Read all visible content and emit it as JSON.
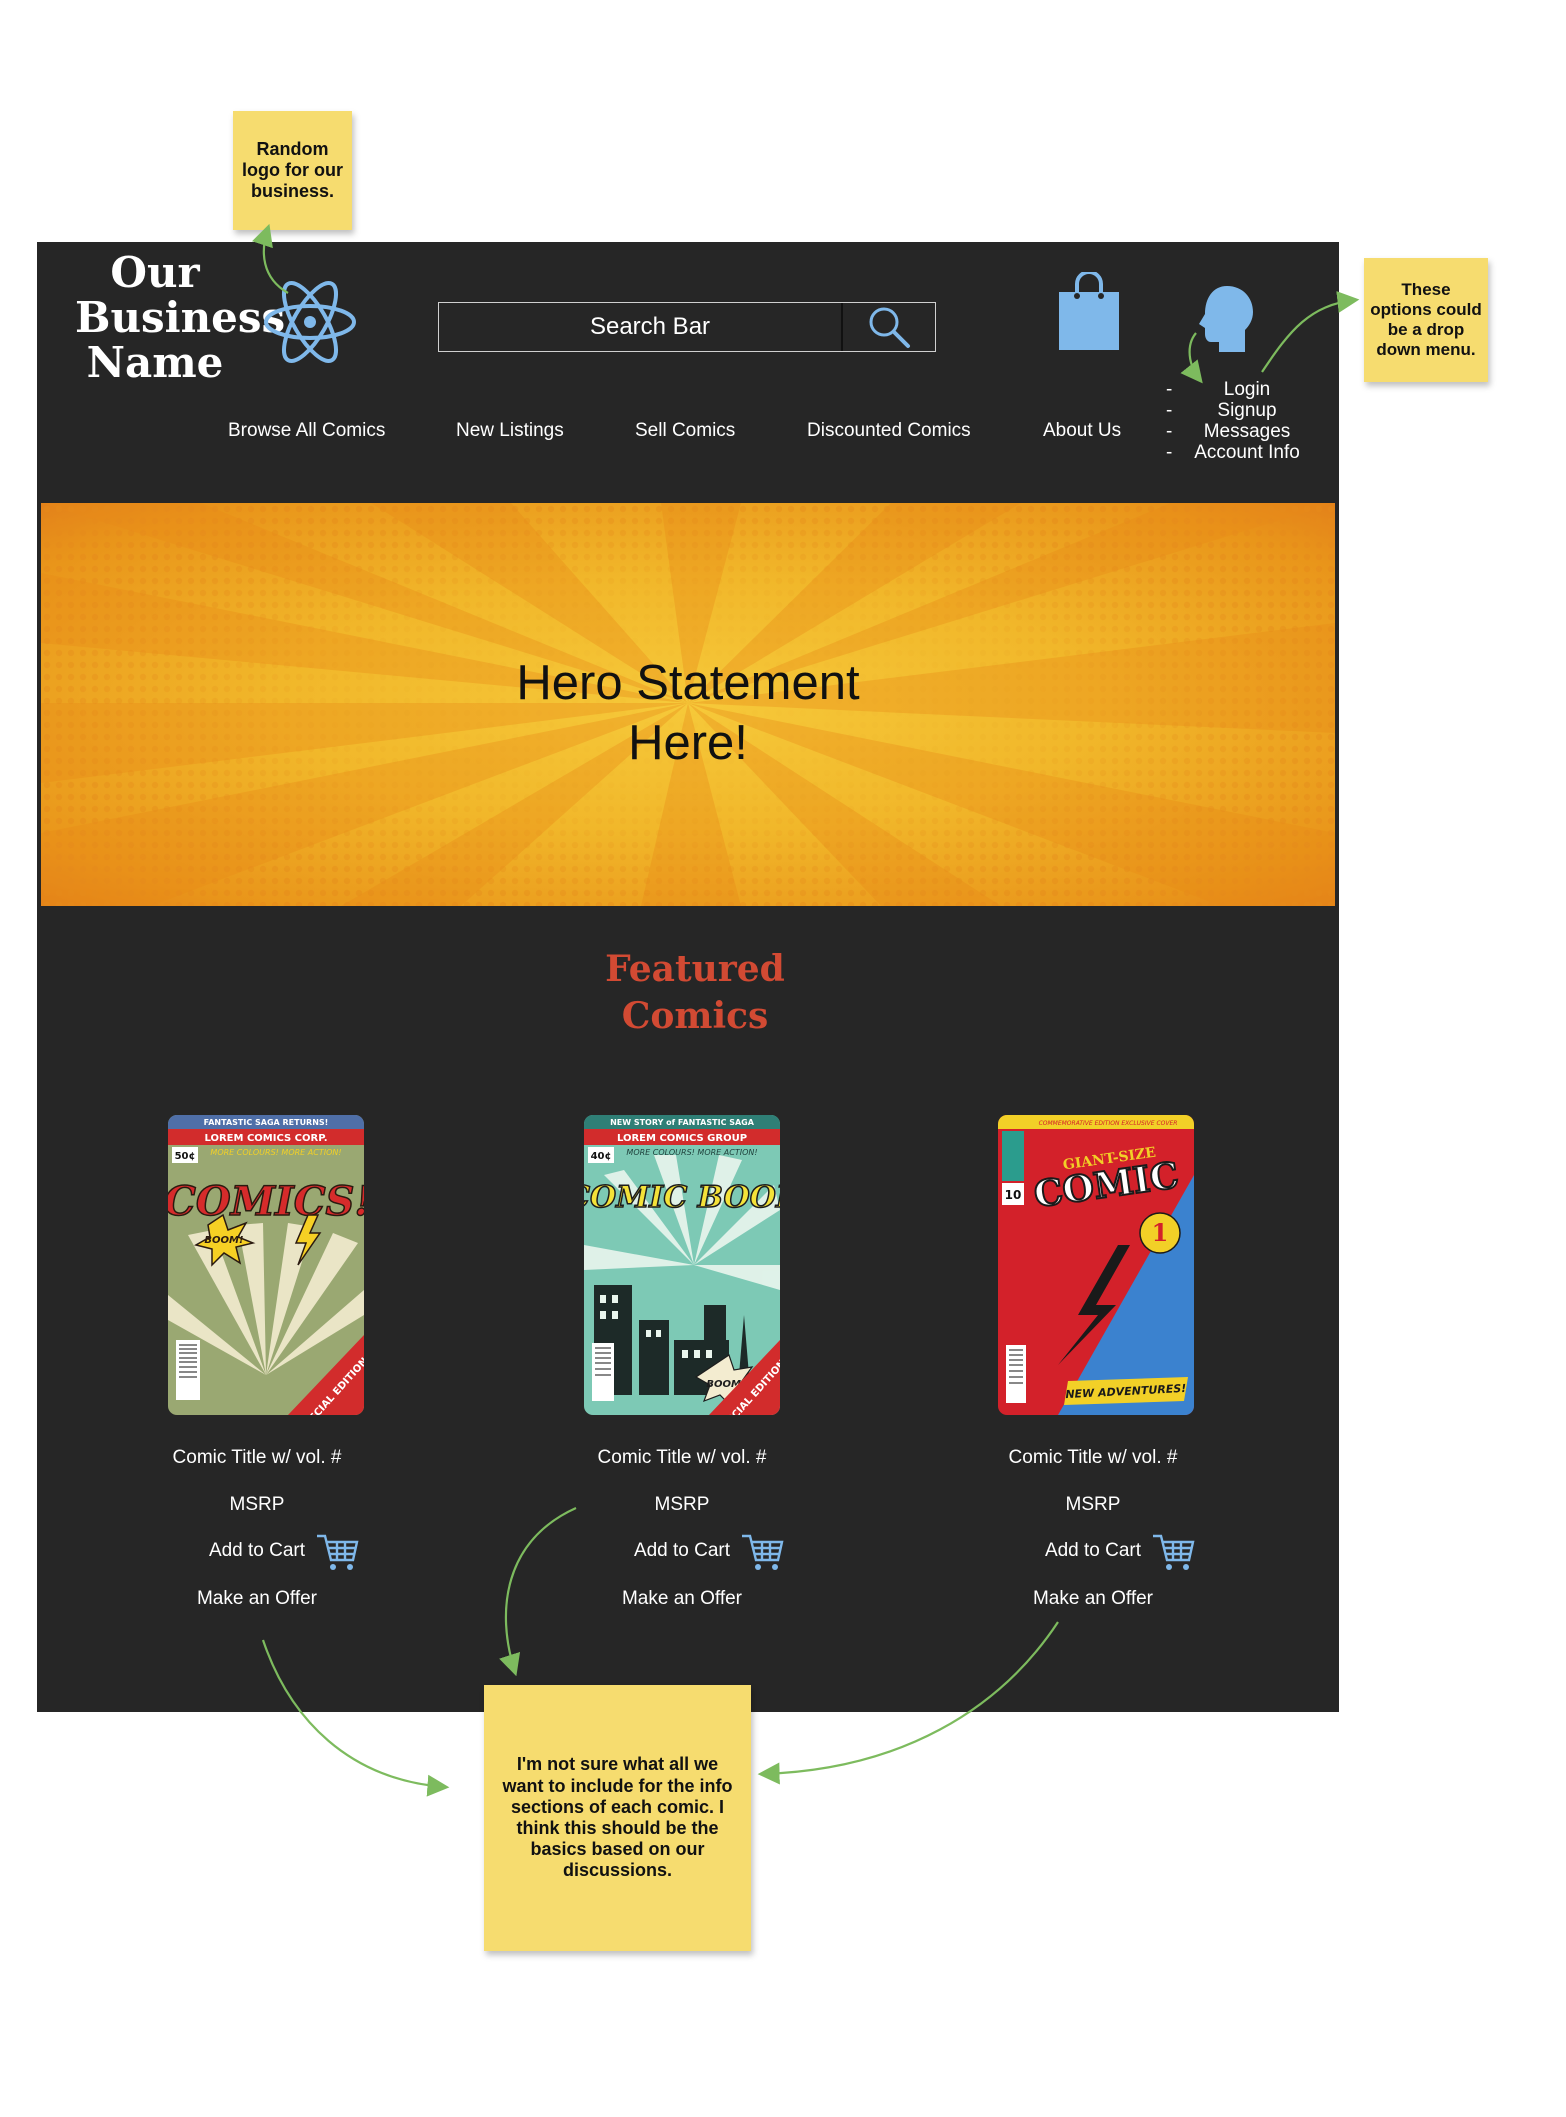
{
  "notes": {
    "logo_note": "Random logo for our business.",
    "menu_note": "These options could be a drop down menu.",
    "info_note": "I'm not sure what all we want to include for the info sections of each comic. I think this should be the basics based on our discussions."
  },
  "header": {
    "logo_text": [
      "Our",
      "Business",
      "Name"
    ],
    "logo_icon": "atom-icon",
    "search": {
      "placeholder": "Search Bar",
      "icon": "magnifier-icon"
    },
    "bag_icon": "shopping-bag-icon",
    "user_icon": "user-head-icon",
    "nav": [
      "Browse All Comics",
      "New Listings",
      "Sell Comics",
      "Discounted Comics",
      "About Us"
    ],
    "account_menu": [
      "Login",
      "Signup",
      "Messages",
      "Account Info"
    ]
  },
  "hero": {
    "line1": "Hero Statement",
    "line2": "Here!"
  },
  "featured": {
    "title_line1": "Featured",
    "title_line2": "Comics",
    "cards": [
      {
        "title": "Comic Title w/ vol. #",
        "msrp": "MSRP",
        "cart": "Add to Cart",
        "offer": "Make an Offer",
        "cover": {
          "banner": "FANTASTIC SAGA RETURNS!",
          "publisher": "LOREM COMICS CORP.",
          "tagline": "MORE COLOURS! MORE ACTION!",
          "price": "50¢",
          "headline": "COMICS!",
          "burst": "BOOM!",
          "corner": "SPECIAL EDITION"
        }
      },
      {
        "title": "Comic Title w/ vol. #",
        "msrp": "MSRP",
        "cart": "Add to Cart",
        "offer": "Make an Offer",
        "cover": {
          "banner": "NEW STORY of FANTASTIC SAGA",
          "publisher": "LOREM COMICS GROUP",
          "tagline": "MORE COLOURS! MORE ACTION!",
          "price": "40¢",
          "headline": "COMIC BOOK",
          "burst": "BOOM!",
          "corner": "SPECIAL EDITION"
        }
      },
      {
        "title": "Comic Title w/ vol. #",
        "msrp": "MSRP",
        "cart": "Add to Cart",
        "offer": "Make an Offer",
        "cover": {
          "banner": "COMMEMORATIVE EDITION  EXCLUSIVE COVER",
          "publisher": "GIANT-SIZE",
          "tagline": "NEW ADVENTURES!",
          "price": "10",
          "headline": "COMIC",
          "burst": "1",
          "corner": ""
        }
      }
    ]
  },
  "colors": {
    "canvas": "#262626",
    "sticky": "#f6dc6f",
    "accent_title": "#d24a33",
    "icon_blue": "#7fb8ea",
    "connector": "#7dbb5e"
  }
}
